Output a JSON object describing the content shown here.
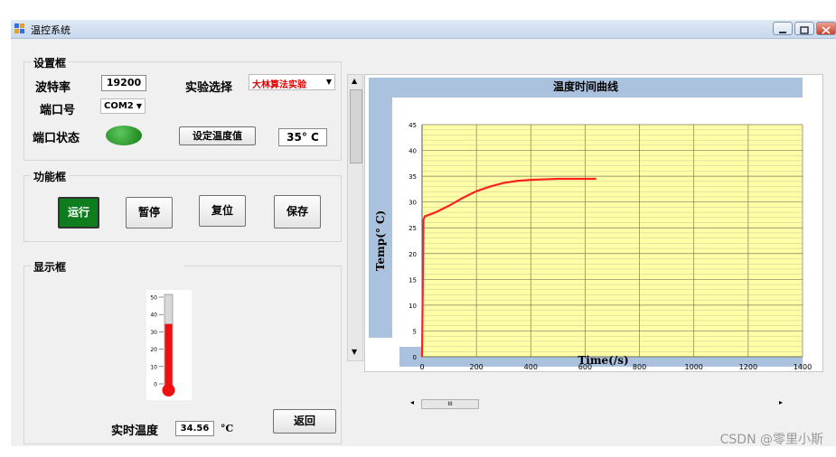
{
  "window": {
    "title": "温控系统"
  },
  "settings": {
    "group_title": "设置框",
    "baud_label": "波特率",
    "baud_value": "19200",
    "experiment_label": "实验选择",
    "experiment_value": "大林算法实验",
    "port_label": "端口号",
    "port_value": "COM2",
    "port_status_label": "端口状态",
    "port_status_color": "#1a8a1a",
    "set_temp_button": "设定温度值",
    "set_temp_value": "35° C"
  },
  "functions": {
    "group_title": "功能框",
    "run_button": "运行",
    "pause_button": "暂停",
    "reset_button": "复位",
    "save_button": "保存"
  },
  "display": {
    "group_title": "显示框",
    "thermo_ticks": [
      "50",
      "40",
      "30",
      "20",
      "10",
      "0"
    ],
    "thermo_level": 34.56,
    "thermo_max": 50,
    "realtime_label": "实时温度",
    "realtime_value": "34.56",
    "realtime_unit": "°C",
    "back_button": "返回"
  },
  "chart_data": {
    "type": "line",
    "title": "温度时间曲线",
    "xlabel": "Time(/s)",
    "ylabel": "Temp(° C)",
    "xlim": [
      0,
      1400
    ],
    "ylim": [
      0,
      45
    ],
    "xticks": [
      0,
      200,
      400,
      600,
      800,
      1000,
      1200,
      1400
    ],
    "yticks": [
      0,
      5,
      10,
      15,
      20,
      25,
      30,
      35,
      40,
      45
    ],
    "grid": true,
    "background": "#ffffa8",
    "line_color": "#ff2020",
    "series": [
      {
        "x": [
          0,
          5,
          10,
          50,
          100,
          150,
          200,
          250,
          300,
          350,
          400,
          450,
          500,
          550,
          600,
          640
        ],
        "y": [
          0,
          26.5,
          27.2,
          28.0,
          29.3,
          30.8,
          32.1,
          33.0,
          33.7,
          34.1,
          34.3,
          34.4,
          34.5,
          34.5,
          34.5,
          34.5
        ]
      }
    ],
    "hscroll_thumb_label": "III"
  },
  "watermark": "CSDN @零里小斯",
  "colors": {
    "run_button_bg": "#0e7d1e",
    "titlebar": "#c7d8ee",
    "chart_header": "#aac2de"
  }
}
